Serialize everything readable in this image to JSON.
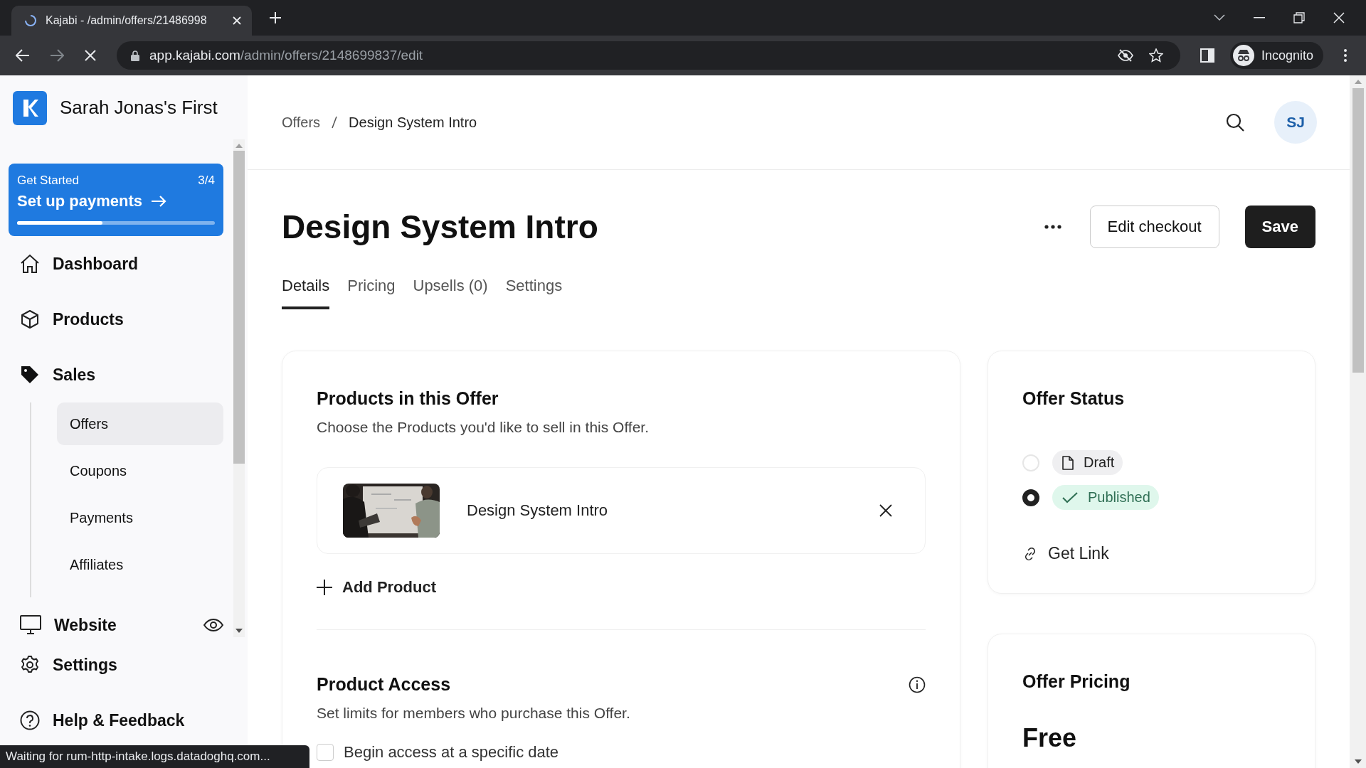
{
  "browser": {
    "tab": {
      "title": "Kajabi - /admin/offers/21486998",
      "loading": true
    },
    "url": {
      "host": "app.kajabi.com",
      "path": "/admin/offers/2148699837/edit"
    },
    "profile": "Incognito"
  },
  "sidebar": {
    "brand": "Sarah Jonas's First",
    "get_started": {
      "label": "Get Started",
      "count": "3/4",
      "action": "Set up payments",
      "level": 0.43
    },
    "items": [
      {
        "label": "Dashboard"
      },
      {
        "label": "Products"
      },
      {
        "label": "Sales",
        "children": [
          {
            "label": "Offers",
            "selected": true
          },
          {
            "label": "Coupons",
            "selected": false
          },
          {
            "label": "Payments",
            "selected": false
          },
          {
            "label": "Affiliates",
            "selected": false
          }
        ]
      },
      {
        "label": "Website"
      }
    ],
    "footer": [
      {
        "label": "Settings"
      },
      {
        "label": "Help & Feedback"
      }
    ]
  },
  "breadcrumb": [
    "Offers",
    "Design System Intro"
  ],
  "avatar": "SJ",
  "title": "Design System Intro",
  "buttons": [
    "Edit checkout",
    "Save"
  ],
  "tabs": [
    {
      "label": "Details",
      "selected": true
    },
    {
      "label": "Pricing",
      "selected": false
    },
    {
      "label": "Upsells (0)",
      "selected": false
    },
    {
      "label": "Settings",
      "selected": false
    }
  ],
  "products_card": {
    "title": "Products in this Offer",
    "subtitle": "Choose the Products you'd like to sell in this Offer.",
    "products": [
      {
        "kind": "picture",
        "name": "Design System Intro"
      }
    ],
    "add": "Add Product"
  },
  "access": {
    "title": "Product Access",
    "subtitle": "Set limits for members who purchase this Offer.",
    "options": [
      {
        "label": "Begin access at a specific date",
        "checked": false
      }
    ]
  },
  "offer_status": {
    "title": "Offer Status",
    "options": [
      {
        "label": "Draft",
        "kind": "draft",
        "selected": false
      },
      {
        "label": "Published",
        "kind": "published",
        "selected": true
      }
    ],
    "link": "Get Link"
  },
  "offer_pricing": {
    "title": "Offer Pricing",
    "price": "Free"
  },
  "status_bar": "Waiting for rum-http-intake.logs.datadoghq.com..."
}
